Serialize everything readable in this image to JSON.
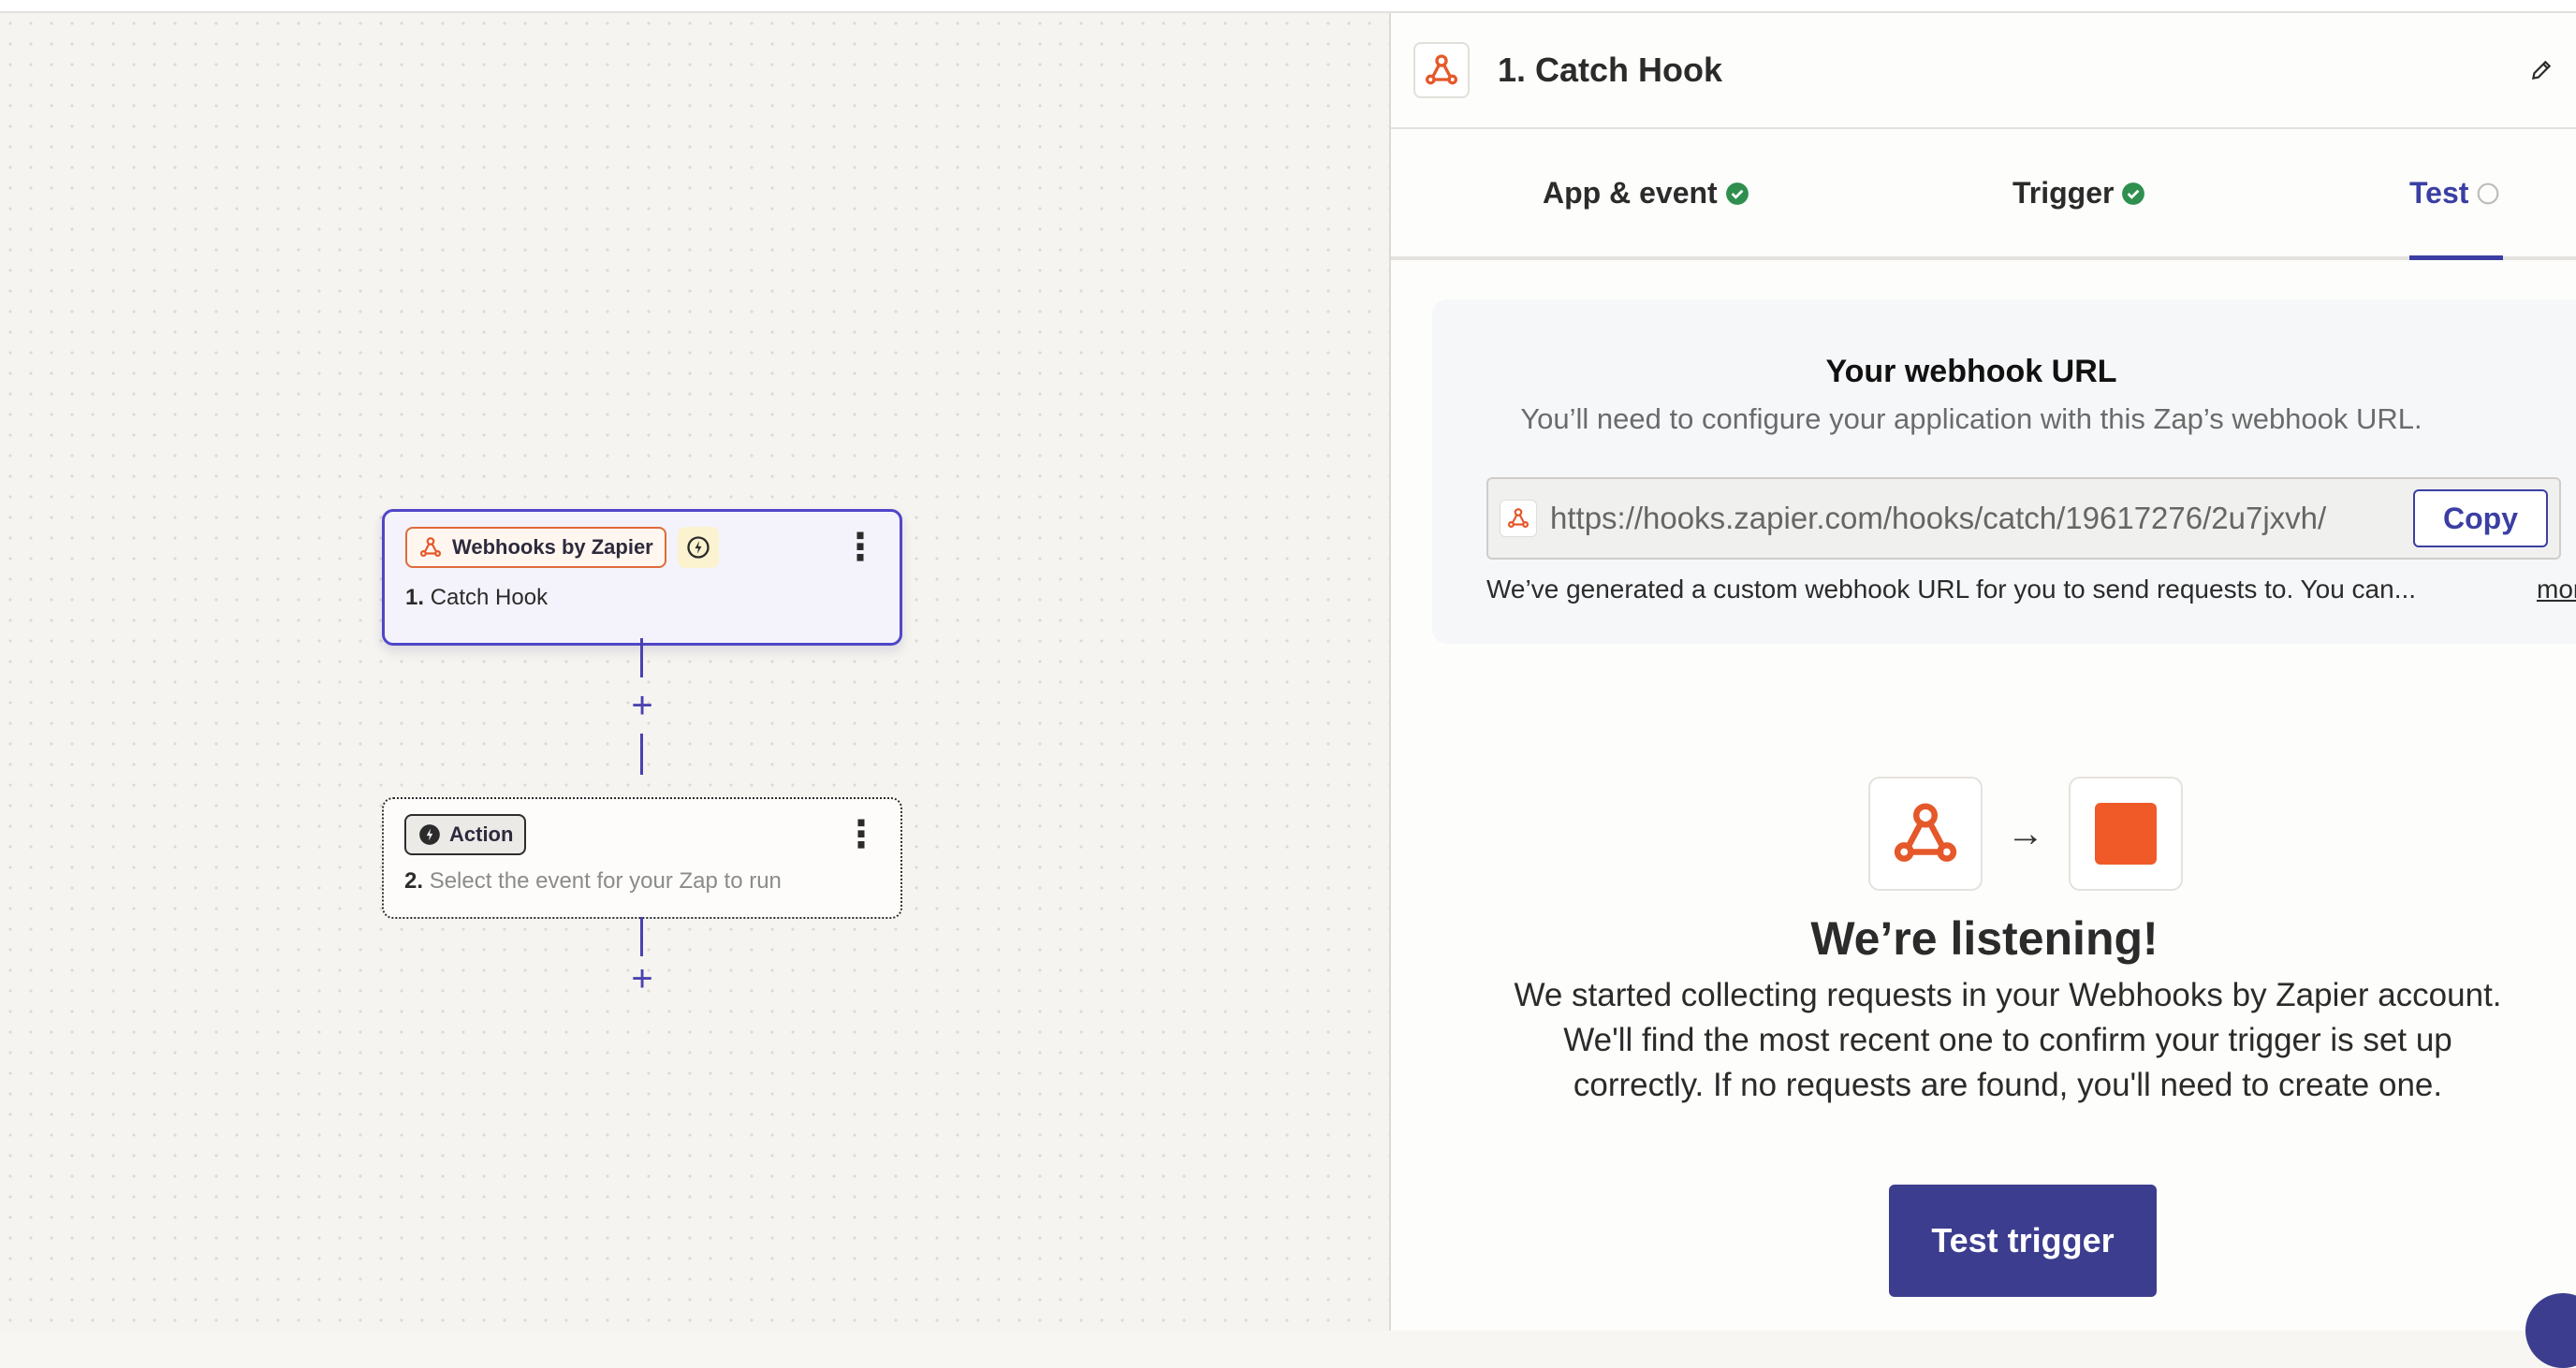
{
  "canvas": {
    "trigger_step": {
      "app_label": "Webhooks by Zapier",
      "number": "1.",
      "title": "Catch Hook"
    },
    "action_step": {
      "badge_label": "Action",
      "number": "2.",
      "placeholder": "Select the event for your Zap to run"
    },
    "add_symbol": "+",
    "menu_symbol": "⋮"
  },
  "panel": {
    "title": "1. Catch Hook",
    "tabs": [
      {
        "label": "App & event",
        "status": "complete"
      },
      {
        "label": "Trigger",
        "status": "complete"
      },
      {
        "label": "Test",
        "status": "pending"
      }
    ],
    "webhook": {
      "title": "Your webhook URL",
      "subtitle": "You’ll need to configure your application with this Zap’s webhook URL.",
      "url": "https://hooks.zapier.com/hooks/catch/19617276/2u7jxvh/",
      "copy_label": "Copy",
      "note": "We’ve generated a custom webhook URL for you to send requests to. You can...",
      "more_label": "more"
    },
    "listening": {
      "arrow": "→",
      "title": "We’re listening!",
      "body": "We started collecting requests in your Webhooks by Zapier account. We'll find the most recent one to confirm your trigger is set up correctly. If no requests are found, you'll need to create one.",
      "button_label": "Test trigger"
    }
  },
  "colors": {
    "accent": "#3b3fa3",
    "brand_orange": "#f05a28",
    "success_green": "#2f8f4e"
  }
}
